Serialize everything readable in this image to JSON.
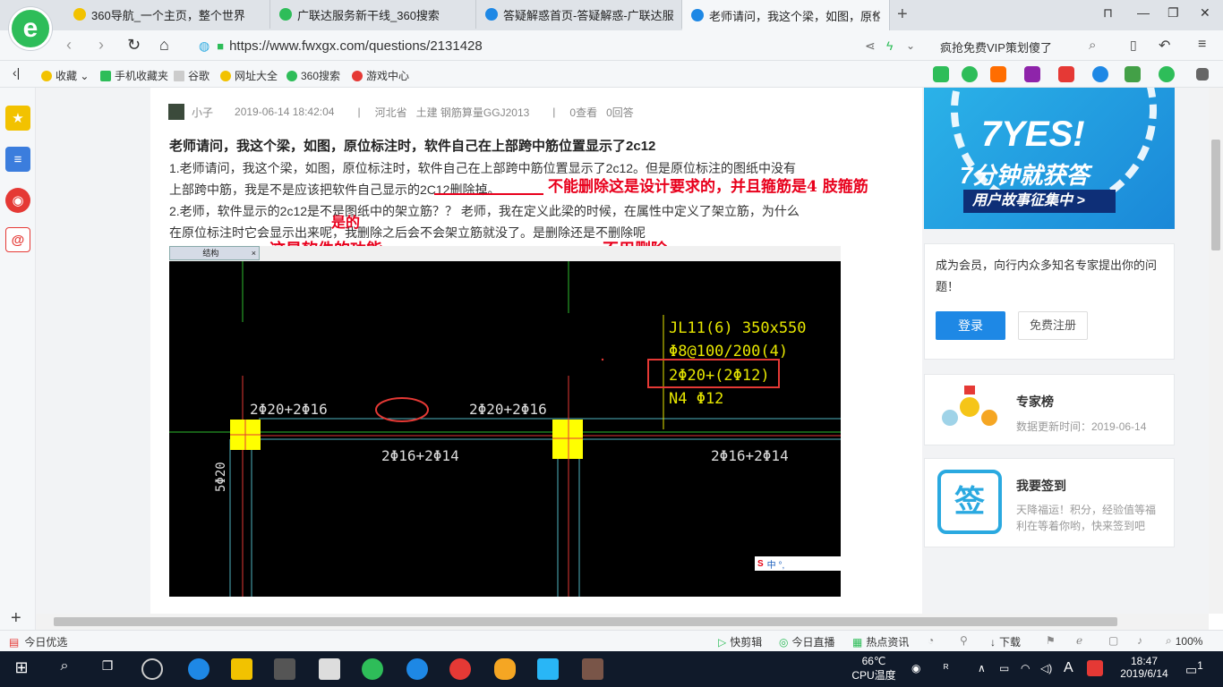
{
  "tabs": [
    {
      "title": "360导航_一个主页，整个世界",
      "color": "#f2c200"
    },
    {
      "title": "广联达服务新干线_360搜索",
      "color": "#2ebd59"
    },
    {
      "title": "答疑解惑首页-答疑解惑-广联达服",
      "color": "#1e88e5"
    },
    {
      "title": "老师请问，我这个梁，如图，原位",
      "color": "#1e88e5"
    }
  ],
  "address": {
    "url": "https://www.fwxgx.com/questions/2131428",
    "promo": "疯抢免费VIP策划傻了"
  },
  "bookmarks": [
    "收藏",
    "手机收藏夹",
    "谷歌",
    "网址大全",
    "360搜索",
    "游戏中心"
  ],
  "question": {
    "author": "小子",
    "datetime": "2019-06-14 18:42:04",
    "region": "河北省",
    "category": "土建 钢筋算量GGJ2013",
    "views": "0查看",
    "answers": "0回答",
    "title": "老师请问，我这个梁，如图，原位标注时，软件自己在上部跨中筋位置显示了2c12",
    "body_line1": "1.老师请问，我这个梁，如图，原位标注时，软件自己在上部跨中筋位置显示了2c12。但是原位标注的图纸中没有",
    "body_line2": "上部跨中筋，我是不是应该把软件自己显示的2C12删除掉。",
    "body_line3": "2.老师，软件显示的2c12是不是图纸中的架立筋？？  老师，我在定义此梁的时候，在属性中定义了架立筋，为什么",
    "body_line4": "在原位标注时它会显示出来呢，我删除之后会不会架立筋就没了。是删除还是不删除呢"
  },
  "annotations": {
    "note1": "不能删除这是设计要求的，并且箍筋是4 肢箍筋",
    "note2": "是的",
    "note3": "这是软件的功能",
    "note4": "不用删除"
  },
  "cad": {
    "tab_label": "结构",
    "beam_name": "JL11(6) 350x550",
    "stirrup": "Φ8@100/200(4)",
    "top_rebar": "2Φ20+(2Φ12)",
    "side_rebar": "N4 Φ12",
    "left_top": "2Φ20+2Φ16",
    "mid_top": "2Φ20+2Φ16",
    "left_bottom": "2Φ16+2Φ14",
    "right_bottom": "2Φ16+2Φ14",
    "vertical": "5Φ20",
    "ime": "中 °,"
  },
  "sidebar": {
    "banner_big": "7YES!",
    "banner_sub": "7分钟就获答",
    "banner_bar": "用户故事征集中 >",
    "member_text": "成为会员，向行内众多知名专家提出你的问题！",
    "login": "登录",
    "register": "免费注册",
    "expert_title": "专家榜",
    "expert_update": "数据更新时间：2019-06-14",
    "sign_title": "我要签到",
    "sign_desc": "天降福运！积分，经验值等福利在等着你哟，快来签到吧",
    "sign_icon_text": "签"
  },
  "statusbar": {
    "today": "今日优选",
    "quickclip": "快剪辑",
    "live": "今日直播",
    "news": "热点资讯",
    "download": "下载",
    "zoom": "100%"
  },
  "taskbar": {
    "temp": "66℃",
    "temp_label": "CPU温度",
    "time": "18:47",
    "date": "2019/6/14",
    "ime": "A",
    "notif": "1"
  }
}
